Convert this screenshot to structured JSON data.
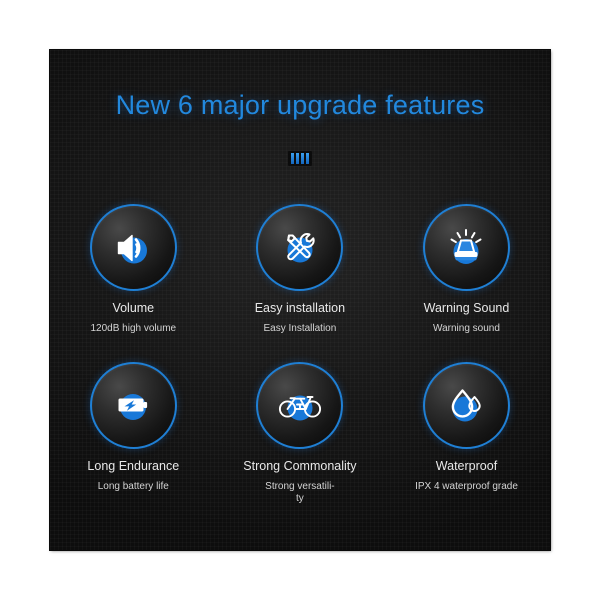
{
  "header": {
    "title": "New 6 major upgrade features",
    "divider_bars": 4
  },
  "colors": {
    "accent_blue": "#2288dd",
    "ring_blue": "#1f7fd4",
    "icon_blue": "#1878d8",
    "panel_dark": "#1b1b1b",
    "text_primary": "#e8e8e8",
    "text_secondary": "#d4d4d4",
    "page_background": "#ffffff"
  },
  "features": [
    {
      "icon": "volume-speaker-icon",
      "label": "Volume",
      "sub": "120dB high volume"
    },
    {
      "icon": "tools-wrench-screwdriver-icon",
      "label": "Easy installation",
      "sub": "Easy Installation"
    },
    {
      "icon": "warning-siren-beacon-icon",
      "label": "Warning Sound",
      "sub": "Warning sound"
    },
    {
      "icon": "battery-charging-icon",
      "label": "Long Endurance",
      "sub": "Long battery life"
    },
    {
      "icon": "bicycle-icon",
      "label": "Strong Commonality",
      "sub": "Strong versatili-\nty"
    },
    {
      "icon": "water-droplets-icon",
      "label": "Waterproof",
      "sub": "IPX 4 waterproof grade"
    }
  ]
}
